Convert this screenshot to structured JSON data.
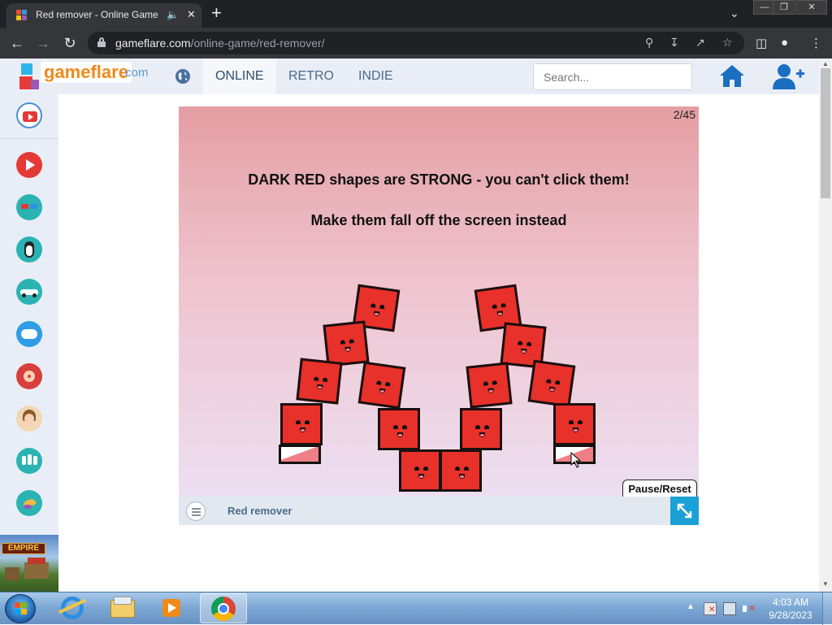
{
  "browser": {
    "tab_title": "Red remover - Online Game",
    "url_host": "gameflare.com",
    "url_path": "/online-game/red-remover/"
  },
  "site": {
    "logo_text": "gameflare",
    "logo_tld": ".com",
    "nav": [
      {
        "label": "ONLINE"
      },
      {
        "label": "RETRO"
      },
      {
        "label": "INDIE"
      }
    ],
    "search_placeholder": "Search..."
  },
  "game": {
    "level_counter": "2/45",
    "instruction_1": "DARK RED shapes are STRONG - you can't click them!",
    "instruction_2": "Make them fall off the screen instead",
    "pause_reset_label": "Pause/Reset",
    "title": "Red remover"
  },
  "sidebar": {
    "ad_text": "EMPIRE",
    "icons": [
      "youtube-icon",
      "play-icon",
      "3d-glasses-icon",
      "penguin-icon",
      "racing-car-icon",
      "gamepad-icon",
      "clown-icon",
      "girl-icon",
      "multiplayer-icon",
      "music-icon"
    ]
  },
  "taskbar": {
    "time": "4:03 AM",
    "date": "9/28/2023"
  },
  "colors": {
    "accent_blue": "#1ba1d6",
    "block_red": "#e8312a",
    "logo_orange": "#f08a19"
  }
}
